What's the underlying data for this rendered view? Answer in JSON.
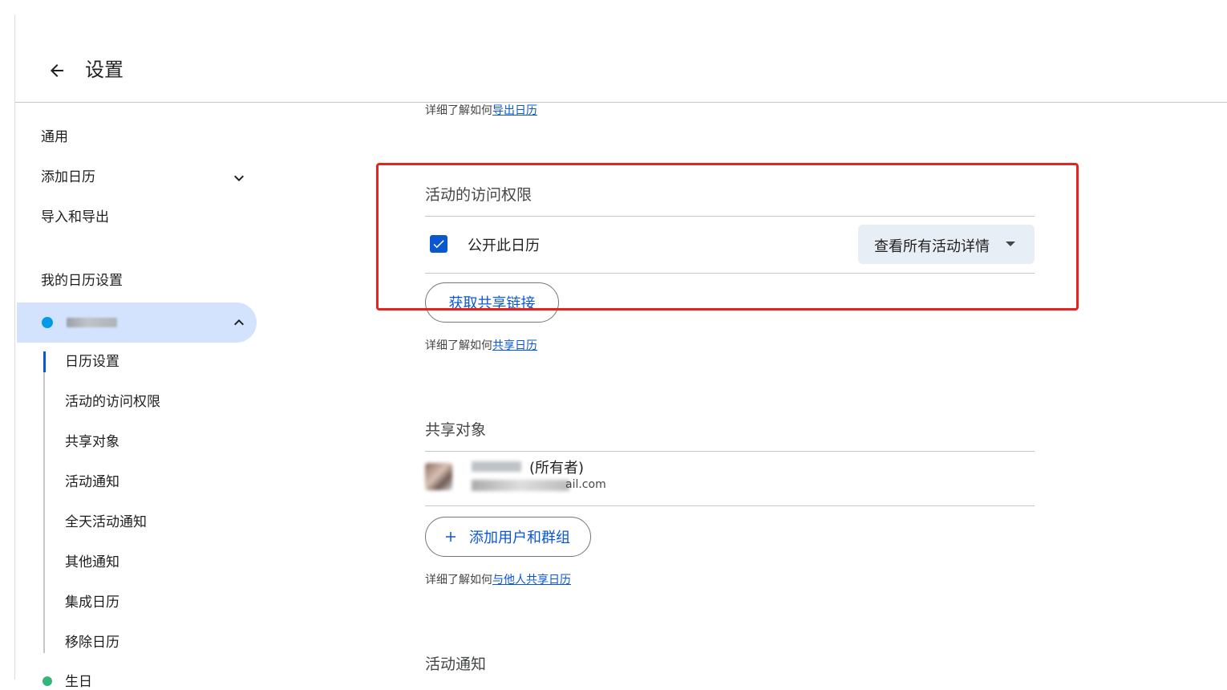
{
  "header": {
    "title": "设置"
  },
  "sidebar": {
    "general": "通用",
    "add_calendar": "添加日历",
    "import_export": "导入和导出",
    "my_settings_heading": "我的日历设置",
    "sub_items": [
      "日历设置",
      "活动的访问权限",
      "共享对象",
      "活动通知",
      "全天活动通知",
      "其他通知",
      "集成日历",
      "移除日历"
    ],
    "next_calendar": "生日"
  },
  "main": {
    "export_learn_prefix": "详细了解如何",
    "export_learn_link": "导出日历",
    "access": {
      "title": "活动的访问权限",
      "public_checkbox_label": "公开此日历",
      "public_checked": true,
      "visibility_select": "查看所有活动详情",
      "share_link_button": "获取共享链接",
      "learn_prefix": "详细了解如何",
      "learn_link": "共享日历"
    },
    "shared": {
      "title": "共享对象",
      "owner_tag": "(所有者)",
      "email_tail": "ail.com",
      "add_button": "添加用户和群组",
      "learn_prefix": "详细了解如何",
      "learn_link": "与他人共享日历"
    },
    "notifications_title": "活动通知"
  },
  "colors": {
    "accent": "#0b57d0",
    "highlight_box": "#e8231f",
    "calendar_dot": "#039be5",
    "birthday_dot": "#33b679",
    "active_nav_bg": "#d3e3fd"
  }
}
